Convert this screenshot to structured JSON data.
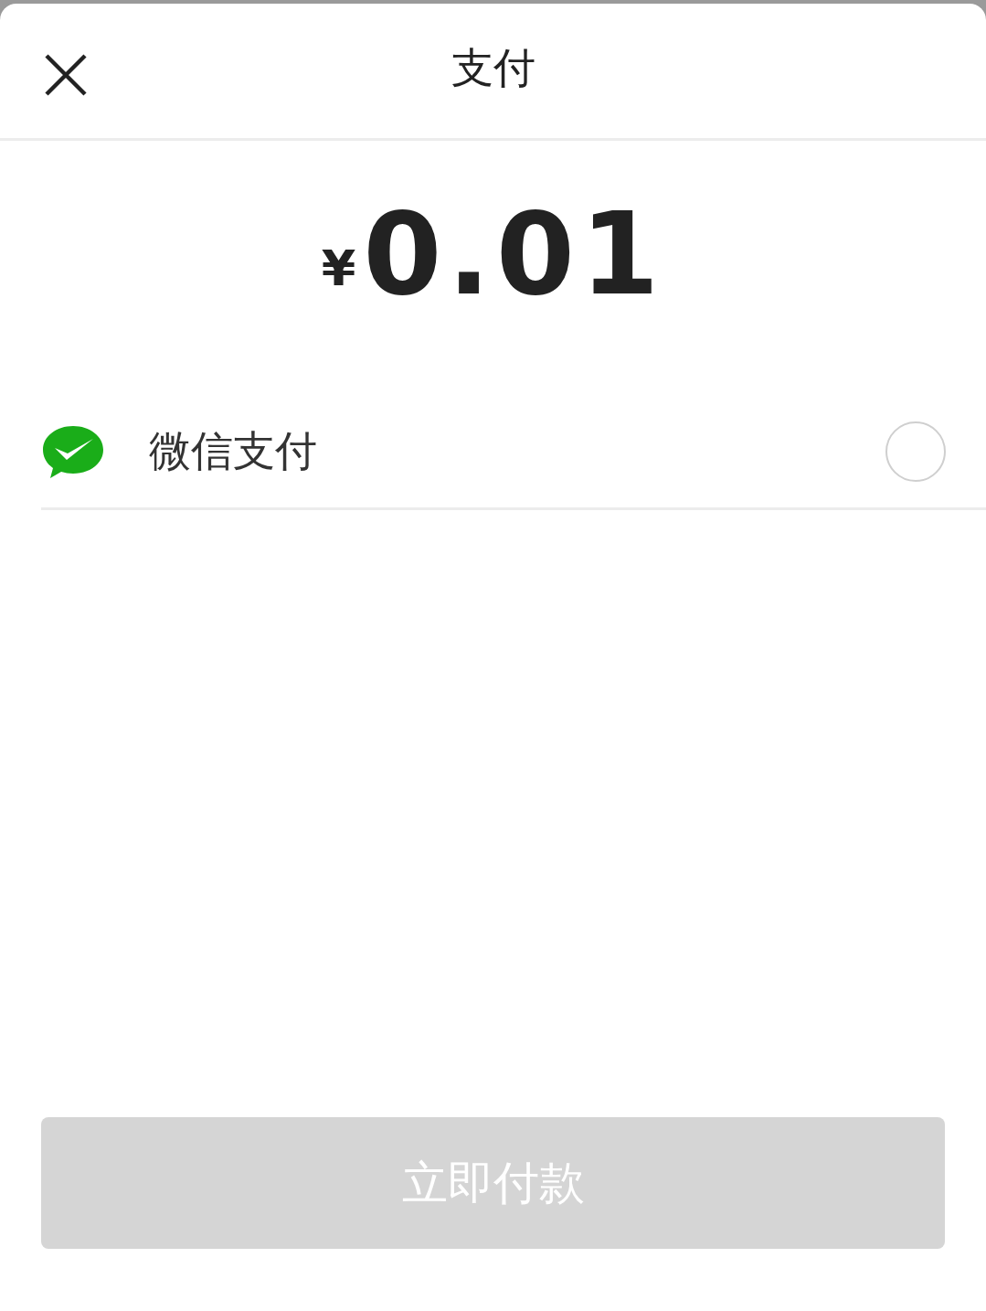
{
  "header": {
    "title": "支付"
  },
  "amount": {
    "currency": "¥",
    "value": "0.01"
  },
  "payment_methods": [
    {
      "label": "微信支付",
      "selected": false
    }
  ],
  "pay_button": {
    "label": "立即付款",
    "disabled": true
  }
}
